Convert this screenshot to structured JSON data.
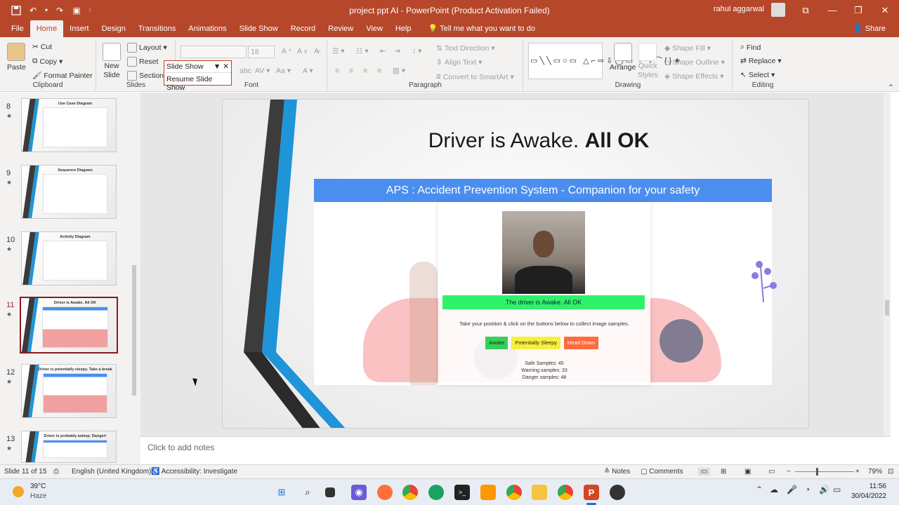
{
  "titlebar": {
    "title": "project ppt AI  -  PowerPoint (Product Activation Failed)",
    "user": "rahul aggarwal",
    "save_icon": "save-icon",
    "controls": [
      "minimize",
      "restore",
      "close"
    ]
  },
  "tabs": [
    "File",
    "Home",
    "Insert",
    "Design",
    "Transitions",
    "Animations",
    "Slide Show",
    "Record",
    "Review",
    "View",
    "Help"
  ],
  "tell_me": "Tell me what you want to do",
  "share": "Share",
  "ribbon": {
    "clipboard": {
      "paste": "Paste",
      "cut": "Cut",
      "copy": "Copy",
      "format_painter": "Format Painter",
      "label": "Clipboard"
    },
    "slides": {
      "new_slide": "New",
      "new_slide2": "Slide",
      "layout": "Layout",
      "reset": "Reset",
      "section": "Section",
      "label": "Slides"
    },
    "font": {
      "size": "18",
      "label": "Font"
    },
    "paragraph": {
      "text_direction": "Text Direction",
      "align_text": "Align Text",
      "smartart": "Convert to SmartArt",
      "label": "Paragraph"
    },
    "drawing": {
      "arrange": "Arrange",
      "quick_styles": "Quick",
      "quick_styles2": "Styles",
      "shape_fill": "Shape Fill",
      "shape_outline": "Shape Outline",
      "shape_effects": "Shape Effects",
      "label": "Drawing"
    },
    "editing": {
      "find": "Find",
      "replace": "Replace",
      "select": "Select",
      "label": "Editing"
    }
  },
  "slideshow_popup": {
    "item1": "Slide Show",
    "item2": "Resume Slide Show"
  },
  "thumbnails": [
    {
      "num": "8",
      "title": "Use Case Diagram"
    },
    {
      "num": "9",
      "title": "Sequence Diagram"
    },
    {
      "num": "10",
      "title": "Activity Diagram"
    },
    {
      "num": "11",
      "title": "Driver is Awake. All OK"
    },
    {
      "num": "12",
      "title": "Driver is potentially sleepy. Take a break"
    },
    {
      "num": "13",
      "title": "Driver is probably asleep. Danger!"
    }
  ],
  "slide": {
    "title_regular": "Driver is Awake. ",
    "title_bold": "All OK",
    "app_header": "APS : Accident Prevention System - Companion for your safety",
    "status": "The driver is Awake. All OK",
    "instruction": "Take your position & click on the buttons below to collect image samples.",
    "buttons": [
      {
        "label": "Awake",
        "color": "#34d058"
      },
      {
        "label": "Potentially Sleepy",
        "color": "#f5f03c"
      },
      {
        "label": "Head Down",
        "color": "#ff6b3d"
      }
    ],
    "samples": [
      "Safe Samples: 45",
      "Warning samples: 33",
      "Danger samples: 48"
    ]
  },
  "notes_placeholder": "Click to add notes",
  "statusbar": {
    "slide_count": "Slide 11 of 15",
    "language": "English (United Kingdom)",
    "accessibility": "Accessibility: Investigate",
    "notes": "Notes",
    "comments": "Comments",
    "zoom": "79%"
  },
  "taskbar": {
    "temp": "39°C",
    "weather": "Haze",
    "time": "11:56",
    "date": "30/04/2022"
  },
  "colors": {
    "accent": "#b7472a",
    "app_header": "#4a8ef0",
    "status_green": "#2ff26a"
  }
}
